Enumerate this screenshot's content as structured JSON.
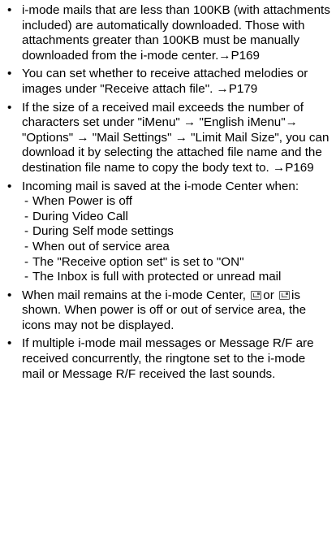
{
  "bullets": [
    {
      "text": "i-mode mails that are less than 100KB (with attachments included) are automatically downloaded. Those with attachments greater than 100KB must be manually downloaded from the i-mode center.→P169"
    },
    {
      "text": "You can set whether to receive attached melodies or images under \"Receive attach file\". →P179"
    },
    {
      "text": "If the size of a received mail exceeds the number of characters set under \"iMenu\" → \"English iMenu\"→ \"Options\" → \"Mail Settings\" → \"Limit Mail Size\", you can download it by selecting the attached file name and the destination file name to copy the body text to. →P169"
    },
    {
      "text": "Incoming mail is saved at the i-mode Center when:",
      "subitems": [
        "When Power is off",
        "During Video Call",
        "During Self mode settings",
        "When out of service area",
        "The \"Receive option set\" is set to \"ON\"",
        "The Inbox is full with protected or unread mail"
      ]
    },
    {
      "text_before": "When mail remains at the i-mode Center,",
      "icon1": "mail-waiting-icon",
      "text_middle": "or",
      "icon2": "mail-full-icon",
      "text_after": "is shown. When power is off or out of service area, the icons may not be displayed."
    },
    {
      "text": "If multiple i-mode mail messages or Message R/F are received concurrently, the ringtone set to the i-mode mail or Message R/F received the last sounds."
    }
  ]
}
